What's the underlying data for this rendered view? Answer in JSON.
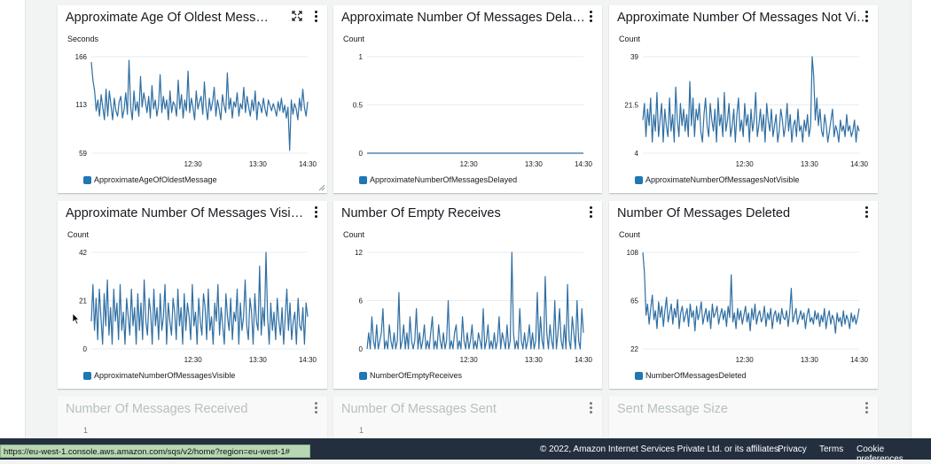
{
  "widgets": [
    {
      "title": "Approximate Age Of Oldest Mess…",
      "unit": "Seconds",
      "legend": "ApproximateAgeOfOldestMessage",
      "has_expand": true,
      "has_resize": true
    },
    {
      "title": "Approximate Number Of Messages Delayed",
      "unit": "Count",
      "legend": "ApproximateNumberOfMessagesDelayed"
    },
    {
      "title": "Approximate Number Of Messages Not Visible",
      "unit": "Count",
      "legend": "ApproximateNumberOfMessagesNotVisible"
    },
    {
      "title": "Approximate Number Of Messages Visible",
      "unit": "Count",
      "legend": "ApproximateNumberOfMessagesVisible"
    },
    {
      "title": "Number Of Empty Receives",
      "unit": "Count",
      "legend": "NumberOfEmptyReceives"
    },
    {
      "title": "Number Of Messages Deleted",
      "unit": "Count",
      "legend": "NumberOfMessagesDeleted"
    },
    {
      "title": "Number Of Messages Received",
      "partial_tick": "1"
    },
    {
      "title": "Number Of Messages Sent",
      "partial_tick": "1"
    },
    {
      "title": "Sent Message Size"
    }
  ],
  "chart_data": [
    {
      "type": "line",
      "ylabel": "Seconds",
      "yticks": [
        59,
        113,
        166
      ],
      "ylim": [
        59,
        166
      ],
      "xticks": [
        "12:30",
        "13:30",
        "14:30"
      ],
      "series": [
        {
          "name": "ApproximateAgeOfOldestMessage",
          "values": [
            160,
            140,
            128,
            106,
            118,
            100,
            124,
            110,
            96,
            130,
            100,
            128,
            112,
            96,
            120,
            106,
            100,
            116,
            122,
            98,
            108,
            126,
            102,
            162,
            110,
            96,
            128,
            106,
            116,
            100,
            144,
            110,
            126,
            116,
            104,
            122,
            98,
            134,
            108,
            118,
            100,
            112,
            146,
            104,
            122,
            108,
            118,
            96,
            128,
            104,
            116,
            112,
            100,
            140,
            108,
            124,
            98,
            118,
            106,
            150,
            104,
            120,
            110,
            96,
            128,
            108,
            116,
            122,
            102,
            138,
            110,
            96,
            120,
            106,
            116,
            132,
            100,
            118,
            108,
            96,
            124,
            112,
            104,
            148,
            108,
            120,
            98,
            116,
            110,
            126,
            100,
            114,
            108,
            132,
            104,
            122,
            110,
            100,
            118,
            106,
            128,
            96,
            116,
            112,
            104,
            120,
            108,
            100,
            118,
            112,
            106,
            114,
            108,
            100,
            116,
            106,
            120,
            104,
            112,
            98,
            110,
            62,
            118,
            102,
            114,
            108,
            96,
            120,
            106,
            130,
            110,
            100,
            116
          ]
        }
      ]
    },
    {
      "type": "line",
      "ylabel": "Count",
      "yticks": [
        0,
        0.5,
        1
      ],
      "ylim": [
        0,
        1
      ],
      "xticks": [
        "12:30",
        "13:30",
        "14:30"
      ],
      "series": [
        {
          "name": "ApproximateNumberOfMessagesDelayed",
          "values": [
            0,
            0
          ]
        }
      ]
    },
    {
      "type": "line",
      "ylabel": "Count",
      "yticks": [
        4,
        21.5,
        39
      ],
      "ylim": [
        4,
        39
      ],
      "xticks": [
        "12:30",
        "13:30",
        "14:30"
      ],
      "series": [
        {
          "name": "ApproximateNumberOfMessagesNotVisible",
          "values": [
            16,
            22,
            10,
            20,
            14,
            24,
            8,
            18,
            12,
            26,
            10,
            16,
            22,
            8,
            20,
            14,
            10,
            24,
            12,
            18,
            8,
            28,
            16,
            10,
            22,
            14,
            20,
            12,
            18,
            10,
            30,
            14,
            24,
            10,
            20,
            16,
            22,
            12,
            8,
            18,
            24,
            14,
            10,
            22,
            16,
            12,
            20,
            8,
            24,
            14,
            18,
            10,
            26,
            12,
            16,
            22,
            10,
            14,
            20,
            8,
            18,
            24,
            12,
            16,
            10,
            22,
            14,
            18,
            8,
            20,
            12,
            16,
            26,
            10,
            14,
            20,
            12,
            18,
            8,
            22,
            16,
            12,
            20,
            10,
            14,
            18,
            8,
            12,
            20,
            16,
            10,
            14,
            22,
            12,
            18,
            8,
            14,
            16,
            10,
            20,
            12,
            14,
            8,
            16,
            12,
            18,
            10,
            14,
            39,
            32,
            16,
            24,
            14,
            20,
            12,
            10,
            18,
            14,
            8,
            12,
            16,
            20,
            10,
            14,
            12,
            8,
            16,
            12,
            14,
            10,
            18,
            12,
            14,
            10,
            12,
            16,
            8,
            14,
            12
          ]
        }
      ]
    },
    {
      "type": "line",
      "ylabel": "Count",
      "yticks": [
        0,
        21,
        42
      ],
      "ylim": [
        0,
        42
      ],
      "xticks": [
        "12:30",
        "13:30",
        "14:30"
      ],
      "series": [
        {
          "name": "ApproximateNumberOfMessagesVisible",
          "values": [
            12,
            28,
            8,
            22,
            4,
            26,
            14,
            2,
            24,
            10,
            30,
            6,
            18,
            2,
            26,
            12,
            20,
            4,
            28,
            8,
            16,
            2,
            22,
            14,
            6,
            26,
            10,
            18,
            2,
            24,
            8,
            20,
            4,
            30,
            12,
            6,
            22,
            16,
            2,
            26,
            10,
            18,
            4,
            24,
            8,
            14,
            28,
            2,
            20,
            12,
            6,
            22,
            16,
            4,
            26,
            10,
            18,
            2,
            24,
            8,
            20,
            14,
            4,
            28,
            10,
            16,
            2,
            22,
            12,
            6,
            24,
            18,
            4,
            26,
            8,
            14,
            2,
            20,
            12,
            28,
            6,
            18,
            10,
            2,
            24,
            14,
            8,
            22,
            4,
            16,
            12,
            26,
            2,
            20,
            8,
            14,
            30,
            10,
            4,
            22,
            16,
            2,
            24,
            12,
            8,
            36,
            6,
            18,
            10,
            42,
            14,
            2,
            20,
            8,
            16,
            4,
            22,
            12,
            6,
            18,
            2,
            14,
            26,
            8,
            20,
            4,
            12,
            16,
            2,
            22,
            10,
            8,
            18,
            2,
            20,
            14
          ]
        }
      ]
    },
    {
      "type": "line",
      "ylabel": "Count",
      "yticks": [
        0,
        6,
        12
      ],
      "ylim": [
        0,
        12
      ],
      "xticks": [
        "12:30",
        "13:30",
        "14:30"
      ],
      "series": [
        {
          "name": "NumberOfEmptyReceives",
          "values": [
            0,
            2,
            0,
            4,
            1,
            0,
            3,
            0,
            1,
            2,
            5,
            0,
            1,
            0,
            3,
            1,
            0,
            2,
            0,
            1,
            7,
            0,
            1,
            3,
            0,
            2,
            0,
            4,
            1,
            0,
            1,
            5,
            0,
            2,
            0,
            1,
            3,
            0,
            1,
            0,
            2,
            4,
            0,
            1,
            0,
            3,
            1,
            0,
            2,
            0,
            1,
            6,
            0,
            1,
            0,
            2,
            3,
            0,
            1,
            0,
            4,
            1,
            0,
            2,
            0,
            1,
            3,
            0,
            1,
            0,
            2,
            1,
            0,
            5,
            0,
            1,
            3,
            0,
            1,
            0,
            2,
            0,
            1,
            4,
            0,
            2,
            1,
            0,
            3,
            0,
            1,
            12,
            2,
            0,
            1,
            0,
            5,
            1,
            0,
            2,
            0,
            1,
            3,
            0,
            2,
            0,
            1,
            7,
            0,
            4,
            1,
            0,
            9,
            2,
            0,
            3,
            1,
            0,
            6,
            0,
            2,
            5,
            1,
            0,
            3,
            0,
            8,
            1,
            0,
            4,
            2,
            0,
            6,
            1,
            0,
            5,
            2
          ]
        }
      ]
    },
    {
      "type": "line",
      "ylabel": "Count",
      "yticks": [
        22,
        65,
        108
      ],
      "ylim": [
        22,
        108
      ],
      "xticks": [
        "12:30",
        "13:30",
        "14:30"
      ],
      "series": [
        {
          "name": "NumberOfMessagesDeleted",
          "values": [
            108,
            90,
            52,
            62,
            44,
            58,
            70,
            48,
            56,
            40,
            64,
            50,
            60,
            42,
            56,
            68,
            46,
            54,
            62,
            44,
            58,
            50,
            66,
            40,
            54,
            60,
            46,
            52,
            58,
            42,
            62,
            50,
            56,
            38,
            60,
            48,
            54,
            64,
            44,
            52,
            58,
            46,
            56,
            40,
            62,
            50,
            54,
            60,
            44,
            52,
            58,
            48,
            56,
            42,
            60,
            50,
            88,
            46,
            54,
            40,
            58,
            48,
            56,
            44,
            52,
            60,
            46,
            54,
            38,
            58,
            48,
            62,
            44,
            52,
            56,
            46,
            50,
            60,
            42,
            54,
            48,
            58,
            40,
            52,
            56,
            46,
            54,
            44,
            58,
            50,
            48,
            56,
            42,
            54,
            76,
            46,
            52,
            58,
            44,
            50,
            56,
            48,
            54,
            40,
            52,
            58,
            46,
            50,
            44,
            56,
            48,
            54,
            42,
            52,
            46,
            58,
            40,
            50,
            56,
            44,
            52,
            48,
            36,
            54,
            46,
            50,
            42,
            56,
            44,
            52,
            48,
            40,
            54,
            46,
            52,
            44,
            50,
            58
          ]
        }
      ]
    }
  ],
  "footer": {
    "copyright": "© 2022, Amazon Internet Services Private Ltd. or its affiliates.",
    "privacy": "Privacy",
    "terms": "Terms",
    "cookies": "Cookie preferences"
  },
  "status_url": "https://eu-west-1.console.aws.amazon.com/sqs/v2/home?region=eu-west-1#",
  "colors": {
    "series": "#2f6fa3",
    "grid": "#e9ebed",
    "footer_bg": "#232f3e"
  }
}
